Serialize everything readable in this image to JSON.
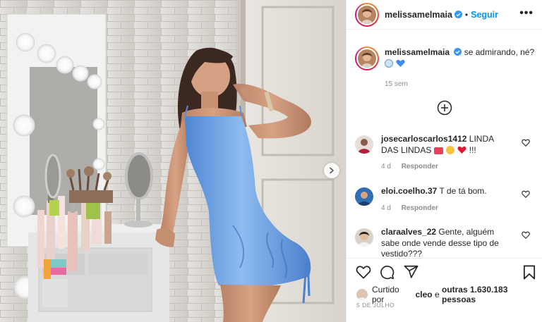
{
  "post": {
    "username": "melissamelmaia",
    "follow_label": "Seguir",
    "separator": "•",
    "more_label": "•••",
    "verified": true
  },
  "caption": {
    "username": "melissamelmaia",
    "text": "se admirando, né?",
    "emojis": [
      "sad-face-emoji",
      "blue-heart-emoji"
    ],
    "time": "15 sem"
  },
  "comments": [
    {
      "username": "josecarloscarlos1412",
      "text": "LINDA DAS LINDAS",
      "emojis": [
        "love-letter-emoji",
        "heart-eyes-emoji",
        "red-heart-emoji"
      ],
      "suffix": "!!!",
      "time": "4 d",
      "reply_label": "Responder"
    },
    {
      "username": "eloi.coelho.37",
      "text": "T de tá bom.",
      "time": "4 d",
      "reply_label": "Responder"
    },
    {
      "username": "claraalves_22",
      "text": "Gente, alguém sabe onde vende desse tipo de vestido???"
    }
  ],
  "likes": {
    "prefix": "Curtido por",
    "user": "cleo",
    "connector": "e",
    "others": "outras 1.630.183 pessoas"
  },
  "date": "5 DE JULHO",
  "icons": {
    "like": "heart-outline-icon",
    "comment": "speech-bubble-icon",
    "share": "paper-plane-icon",
    "save": "bookmark-icon",
    "load_more": "plus-circle-icon",
    "next": "chevron-right-icon"
  },
  "colors": {
    "accent": "#0095f6",
    "dress": "#6ea6e6",
    "muted": "#8e8e8e"
  }
}
